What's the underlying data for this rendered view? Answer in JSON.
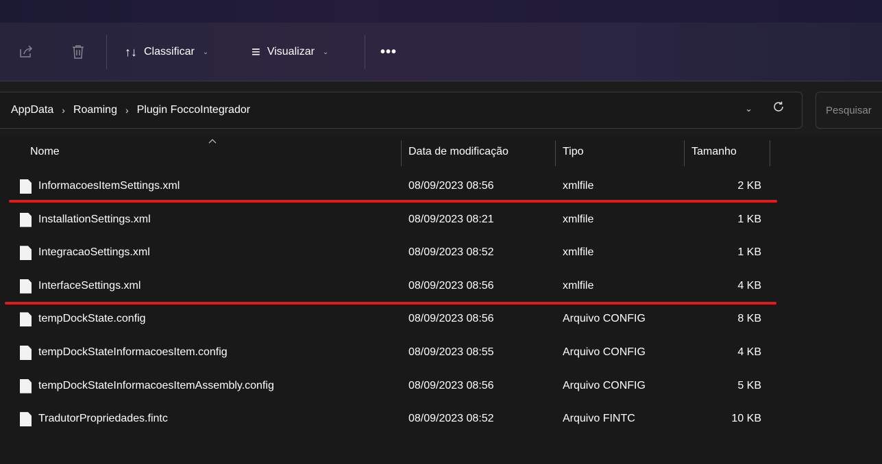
{
  "toolbar": {
    "share_icon": "share-icon",
    "delete_icon": "trash-icon",
    "sort_icon": "↑↓",
    "sort_label": "Classificar",
    "view_icon": "≡",
    "view_label": "Visualizar",
    "more_label": "•••",
    "chevron": "⌄"
  },
  "address": {
    "breadcrumbs": [
      "AppData",
      "Roaming",
      "Plugin FoccoIntegrador"
    ],
    "separator": "›",
    "chevron": "⌄",
    "refresh_icon": "C"
  },
  "search": {
    "placeholder": "Pesquisar"
  },
  "columns": {
    "name": "Nome",
    "date": "Data de modificação",
    "type": "Tipo",
    "size": "Tamanho",
    "sort_caret": "^"
  },
  "files": [
    {
      "name": "InformacoesItemSettings.xml",
      "date": "08/09/2023 08:56",
      "type": "xmlfile",
      "size": "2 KB"
    },
    {
      "name": "InstallationSettings.xml",
      "date": "08/09/2023 08:21",
      "type": "xmlfile",
      "size": "1 KB"
    },
    {
      "name": "IntegracaoSettings.xml",
      "date": "08/09/2023 08:52",
      "type": "xmlfile",
      "size": "1 KB"
    },
    {
      "name": "InterfaceSettings.xml",
      "date": "08/09/2023 08:56",
      "type": "xmlfile",
      "size": "4 KB"
    },
    {
      "name": "tempDockState.config",
      "date": "08/09/2023 08:56",
      "type": "Arquivo CONFIG",
      "size": "8 KB"
    },
    {
      "name": "tempDockStateInformacoesItem.config",
      "date": "08/09/2023 08:55",
      "type": "Arquivo CONFIG",
      "size": "4 KB"
    },
    {
      "name": "tempDockStateInformacoesItemAssembly.config",
      "date": "08/09/2023 08:56",
      "type": "Arquivo CONFIG",
      "size": "5 KB"
    },
    {
      "name": "TradutorPropriedades.fintc",
      "date": "08/09/2023 08:52",
      "type": "Arquivo FINTC",
      "size": "10 KB"
    }
  ],
  "colors": {
    "annotation": "#e01b1b",
    "background": "#191919",
    "toolbar": "#2a2540"
  }
}
